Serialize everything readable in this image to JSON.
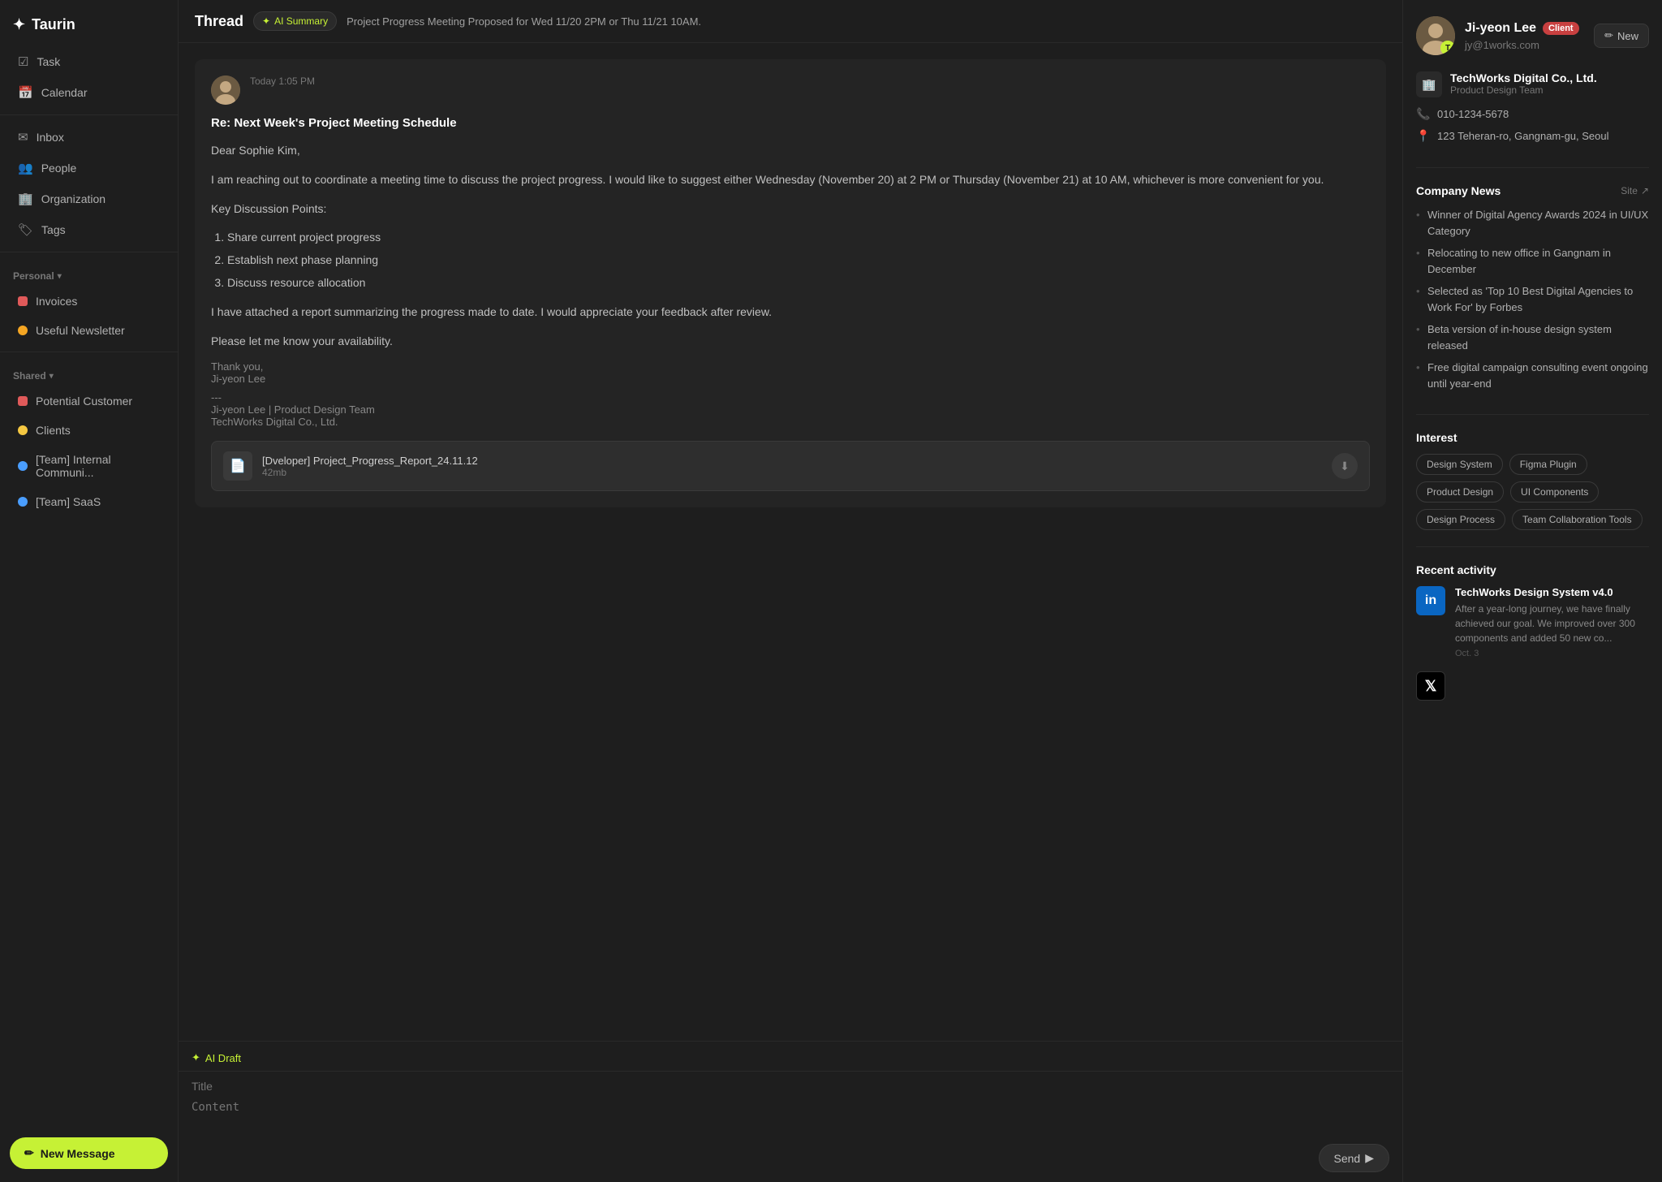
{
  "app": {
    "name": "Taurin",
    "logo_icon": "✦"
  },
  "sidebar": {
    "nav_items": [
      {
        "id": "task",
        "label": "Task",
        "icon": "☑"
      },
      {
        "id": "calendar",
        "label": "Calendar",
        "icon": "📅"
      }
    ],
    "main_items": [
      {
        "id": "inbox",
        "label": "Inbox",
        "icon": "✉"
      },
      {
        "id": "people",
        "label": "People",
        "icon": "👥"
      },
      {
        "id": "organization",
        "label": "Organization",
        "icon": "🏢"
      },
      {
        "id": "tags",
        "label": "Tags",
        "icon": "🏷"
      }
    ],
    "personal_section": "Personal",
    "personal_items": [
      {
        "id": "invoices",
        "label": "Invoices",
        "color": "#e05a5a"
      },
      {
        "id": "newsletter",
        "label": "Useful Newsletter",
        "color": "#f5a623"
      }
    ],
    "shared_section": "Shared",
    "shared_items": [
      {
        "id": "potential-customer",
        "label": "Potential Customer",
        "color": "#e05a5a"
      },
      {
        "id": "clients",
        "label": "Clients",
        "color": "#f5c842",
        "type": "person"
      },
      {
        "id": "team-internal",
        "label": "[Team] Internal Communi...",
        "color": "#4a9eff",
        "type": "team"
      },
      {
        "id": "team-saas",
        "label": "[Team] SaaS",
        "color": "#4a9eff",
        "type": "team"
      }
    ],
    "new_message_label": "New Message",
    "new_message_icon": "✏"
  },
  "thread": {
    "title": "Thread",
    "ai_summary_label": "AI Summary",
    "ai_summary_icon": "✦",
    "summary_text": "Project Progress Meeting Proposed for Wed 11/20 2PM or Thu 11/21 10AM."
  },
  "email": {
    "timestamp": "Today 1:05 PM",
    "subject": "Re: Next Week's Project Meeting Schedule",
    "greeting": "Dear Sophie Kim,",
    "body_1": "I am reaching out to coordinate a meeting time to discuss the project progress. I would like to suggest either Wednesday (November 20) at 2 PM or Thursday (November 21) at 10 AM, whichever is more convenient for you.",
    "key_points_label": "Key Discussion Points:",
    "key_points": [
      "Share current project progress",
      "Establish next phase planning",
      "Discuss resource allocation"
    ],
    "body_2": "I have attached a report summarizing the progress made to date. I would appreciate your feedback after review.",
    "body_3": "Please let me know your availability.",
    "closing": "Thank you,",
    "sender_name": "Ji-yeon Lee",
    "separator": "---",
    "signature_name": "Ji-yeon Lee | Product Design Team",
    "signature_company": "TechWorks Digital Co., Ltd.",
    "attachment": {
      "name": "[Dveloper] Project_Progress_Report_24.11.12",
      "size": "42mb",
      "icon": "📄",
      "download_icon": "⬇"
    }
  },
  "reply": {
    "ai_draft_label": "AI Draft",
    "ai_draft_icon": "✦",
    "title_placeholder": "Title",
    "content_placeholder": "Content",
    "send_label": "Send",
    "send_icon": "▶"
  },
  "right_panel": {
    "contact": {
      "name": "Ji-yeon Lee",
      "client_badge": "Client",
      "email": "jy@1works.com",
      "avatar_initials": "👩",
      "avatar_badge": "T"
    },
    "new_button": "New",
    "new_button_icon": "✏",
    "company": {
      "name": "TechWorks Digital Co., Ltd.",
      "department": "Product Design Team",
      "phone": "010-1234-5678",
      "address": "123 Teheran-ro, Gangnam-gu, Seoul"
    },
    "company_news": {
      "title": "Company News",
      "site_label": "Site",
      "site_icon": "↗",
      "items": [
        "Winner of Digital Agency Awards 2024 in UI/UX Category",
        "Relocating to new office in Gangnam in December",
        "Selected as 'Top 10 Best Digital Agencies to Work For' by Forbes",
        "Beta version of in-house design system released",
        "Free digital campaign consulting event ongoing until year-end"
      ]
    },
    "interest": {
      "title": "Interest",
      "tags": [
        "Design System",
        "Figma Plugin",
        "Product Design",
        "UI Components",
        "Design Process",
        "Team Collaboration Tools"
      ]
    },
    "recent_activity": {
      "title": "Recent activity",
      "items": [
        {
          "id": "linkedin-post",
          "platform": "linkedin",
          "platform_label": "in",
          "title": "TechWorks Design System v4.0",
          "text": "After a year-long journey, we have finally achieved our goal. We improved over 300 components and added 50 new co...",
          "date": "Oct. 3"
        },
        {
          "id": "twitter-post",
          "platform": "twitter",
          "platform_label": "𝕏",
          "title": "",
          "text": "",
          "date": ""
        }
      ]
    }
  }
}
